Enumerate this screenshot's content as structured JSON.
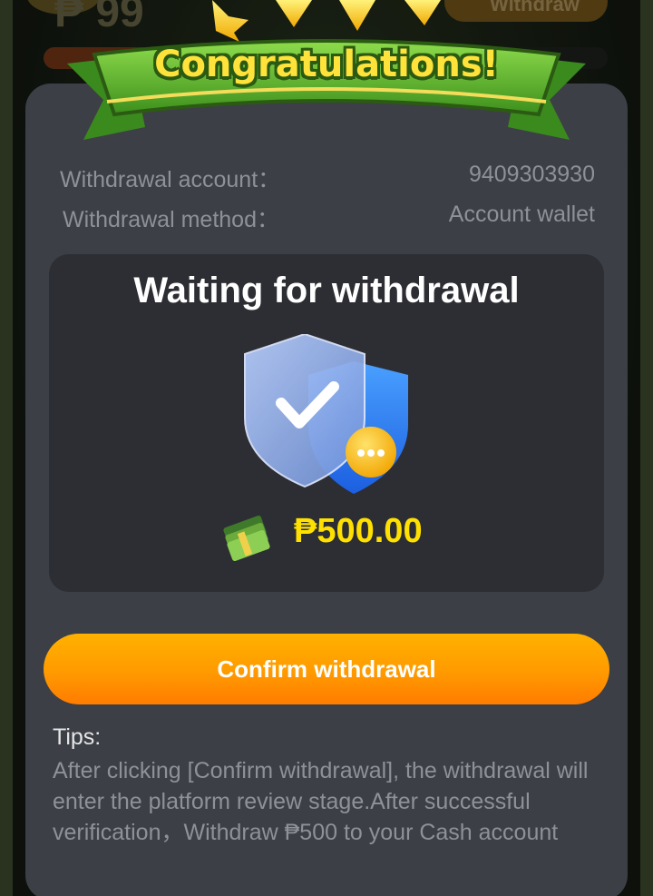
{
  "background": {
    "balance": "₱ 99",
    "withdraw_button": "Withdraw"
  },
  "banner": {
    "title": "Congratulations!"
  },
  "info": {
    "account_label": "Withdrawal account：",
    "account_value": "9409303930",
    "method_label": "Withdrawal method：",
    "method_value": "Account wallet"
  },
  "status": {
    "title": "Waiting for withdrawal",
    "amount": "₱500.00"
  },
  "confirm_button": "Confirm withdrawal",
  "tips": {
    "title": "Tips:",
    "body": "After clicking [Confirm withdrawal], the withdrawal will enter the platform review stage.After successful verification，Withdraw  ₱500 to your Cash account"
  },
  "colors": {
    "modal_bg": "#3c3f46",
    "card_bg": "#2c2e33",
    "amount": "#ffe000",
    "button_start": "#ffb100",
    "button_end": "#ff7c00",
    "banner_green": "#5fb52b",
    "banner_text": "#ffe23a"
  }
}
